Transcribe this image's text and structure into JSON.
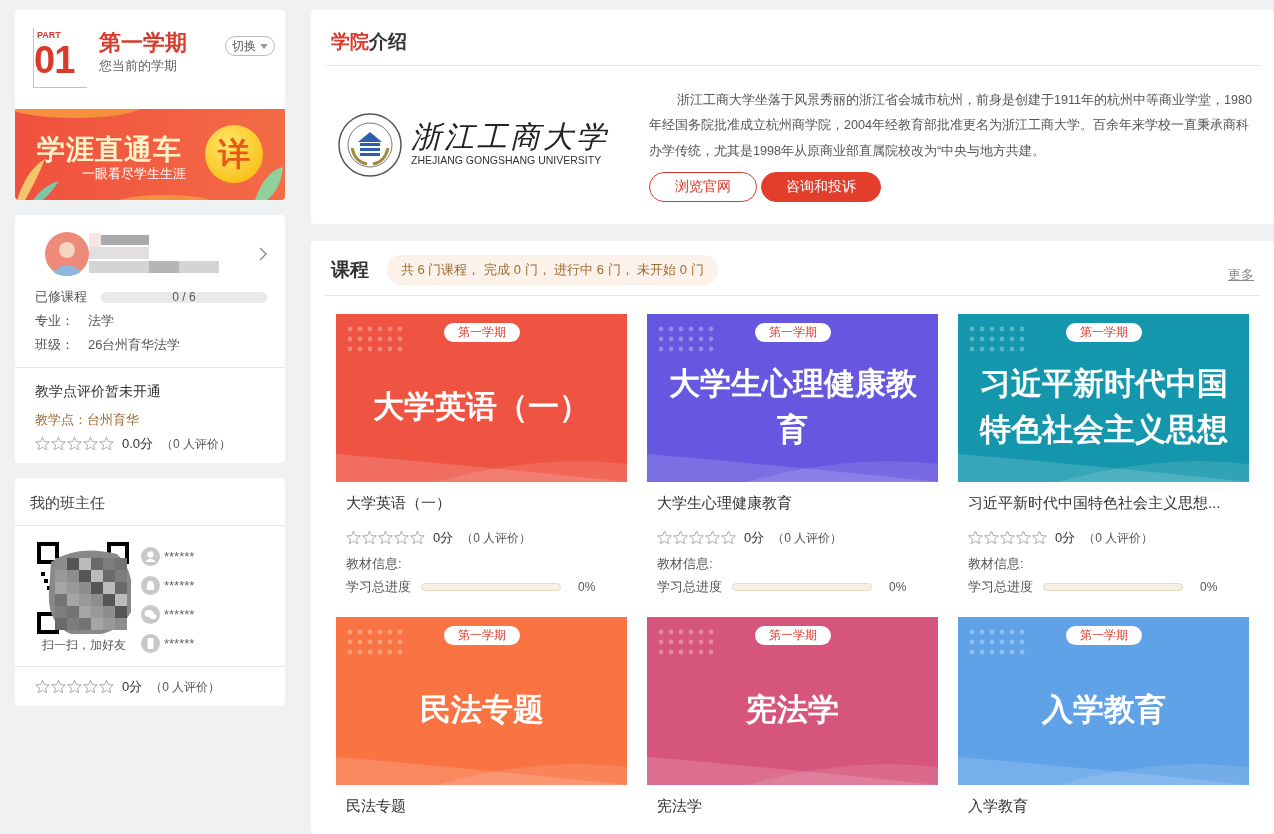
{
  "semester": {
    "part": "PART",
    "number": "01",
    "title": "第一学期",
    "subtitle": "您当前的学期",
    "switch_label": "切换"
  },
  "banner": {
    "title": "学涯直通车",
    "subtitle": "一眼看尽学生生涯",
    "badge": "详"
  },
  "student": {
    "progress_label": "已修课程",
    "progress_text": "0 / 6",
    "level": 0,
    "fields": [
      {
        "label": "专业：",
        "value": "法学"
      },
      {
        "label": "班级：",
        "value": "26台州育华法学"
      }
    ],
    "evaluation_notice": "教学点评价暂未开通",
    "site_label": "教学点：",
    "site": "台州育华",
    "stars": 0,
    "score": "0.0分",
    "reviews": "（0 人评价）"
  },
  "teacher": {
    "title": "我的班主任",
    "qr_caption": "扫一扫，加好友",
    "contacts": [
      {
        "kind": "person",
        "value": "******"
      },
      {
        "kind": "qq",
        "value": "******"
      },
      {
        "kind": "wechat",
        "value": "******"
      },
      {
        "kind": "phone",
        "value": "******"
      }
    ],
    "stars": 0,
    "score": "0分",
    "reviews": "（0 人评价）"
  },
  "college": {
    "title_accent": "学院",
    "title_rest": "介绍",
    "logo_name": "浙江工商大学",
    "logo_english": "ZHEJIANG GONGSHANG UNIVERSITY",
    "description": "浙江工商大学坐落于风景秀丽的浙江省会城市杭州，前身是创建于1911年的杭州中等商业学堂，1980年经国务院批准成立杭州商学院，2004年经教育部批准更名为浙江工商大学。百余年来学校一直秉承商科办学传统，尤其是1998年从原商业部直属院校改为“中央与地方共建。",
    "buttons": [
      {
        "label": "浏览官网",
        "kind": "outline"
      },
      {
        "label": "咨询和投诉",
        "kind": "solid"
      }
    ]
  },
  "courses": {
    "title": "课程",
    "summary": "共 6 门课程， 完成 0 门， 进行中 6 门， 未开始 0 门",
    "more": "更多",
    "items": [
      {
        "term": "第一学期",
        "cover_title": "大学英语（一）",
        "color": "#ef5443",
        "name": "大学英语（一）",
        "stars": 0,
        "score": "0分",
        "reviews": "（0 人评价）",
        "materials_label": "教材信息:",
        "progress_label": "学习总进度",
        "level": 0,
        "progress_text": "0%"
      },
      {
        "term": "第一学期",
        "cover_title": "大学生心理健康教育",
        "color": "#6656e0",
        "name": "大学生心理健康教育",
        "stars": 0,
        "score": "0分",
        "reviews": "（0 人评价）",
        "materials_label": "教材信息:",
        "progress_label": "学习总进度",
        "level": 0,
        "progress_text": "0%"
      },
      {
        "term": "第一学期",
        "cover_title": "习近平新时代中国特色社会主义思想",
        "color": "#1497ad",
        "name": "习近平新时代中国特色社会主义思想...",
        "stars": 0,
        "score": "0分",
        "reviews": "（0 人评价）",
        "materials_label": "教材信息:",
        "progress_label": "学习总进度",
        "level": 0,
        "progress_text": "0%"
      },
      {
        "term": "第一学期",
        "cover_title": "民法专题",
        "color": "#f97442",
        "name": "民法专题"
      },
      {
        "term": "第一学期",
        "cover_title": "宪法学",
        "color": "#d6557d",
        "name": "宪法学"
      },
      {
        "term": "第一学期",
        "cover_title": "入学教育",
        "color": "#5fa2e8",
        "name": "入学教育"
      }
    ]
  }
}
